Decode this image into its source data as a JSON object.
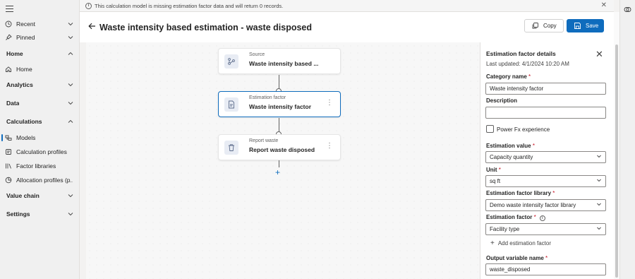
{
  "nav": {
    "items": [
      {
        "label": "Recent",
        "icon": "clock-icon",
        "chevron": "chevron-down-icon"
      },
      {
        "label": "Pinned",
        "icon": "pin-icon",
        "chevron": "chevron-down-icon"
      },
      {
        "label": "Home",
        "section": true,
        "chevron": "chevron-up-icon"
      },
      {
        "label": "Home",
        "icon": "home-icon"
      },
      {
        "label": "Analytics",
        "section": true,
        "chevron": "chevron-down-icon"
      },
      {
        "label": "Data",
        "section": true,
        "chevron": "chevron-down-icon"
      },
      {
        "label": "Calculations",
        "section": true,
        "chevron": "chevron-up-icon"
      },
      {
        "label": "Models",
        "icon": "models-icon",
        "active": true
      },
      {
        "label": "Calculation profiles",
        "icon": "profile-icon"
      },
      {
        "label": "Factor libraries",
        "icon": "library-icon"
      },
      {
        "label": "Allocation profiles (p...",
        "icon": "allocation-icon"
      },
      {
        "label": "Value chain",
        "section": true,
        "chevron": "chevron-down-icon"
      },
      {
        "label": "Settings",
        "section": true,
        "chevron": "chevron-down-icon"
      }
    ]
  },
  "banner": {
    "message": "This calculation model is missing estimation factor data and will return 0 records.",
    "icon": "info-icon"
  },
  "header": {
    "title": "Waste intensity based estimation - waste disposed",
    "copy_label": "Copy",
    "save_label": "Save"
  },
  "canvas": {
    "nodes": [
      {
        "caption": "Source",
        "name": "Waste intensity based ...",
        "icon": "source-icon"
      },
      {
        "caption": "Estimation factor",
        "name": "Waste intensity factor",
        "icon": "document-icon"
      },
      {
        "caption": "Report waste",
        "name": "Report waste disposed",
        "icon": "bin-icon"
      }
    ]
  },
  "panel": {
    "title": "Estimation factor details",
    "last_updated": "Last updated: 4/1/2024 10:20 AM",
    "category_label": "Category name",
    "category_value": "Waste intensity factor",
    "description_label": "Description",
    "description_value": "",
    "powerfx_label": "Power Fx experience",
    "estimation_value_label": "Estimation value",
    "estimation_value": "Capacity quantity",
    "unit_label": "Unit",
    "unit_value": "sq ft",
    "library_label": "Estimation factor library",
    "library_value": "Demo waste intensity factor library",
    "factor_label": "Estimation factor",
    "factor_value": "Facility type",
    "add_factor_label": "Add estimation factor",
    "output_label": "Output variable name",
    "output_value": "waste_disposed",
    "required_mark": "*"
  },
  "colors": {
    "accent": "#0f6cbd",
    "required": "#c50f1f"
  }
}
